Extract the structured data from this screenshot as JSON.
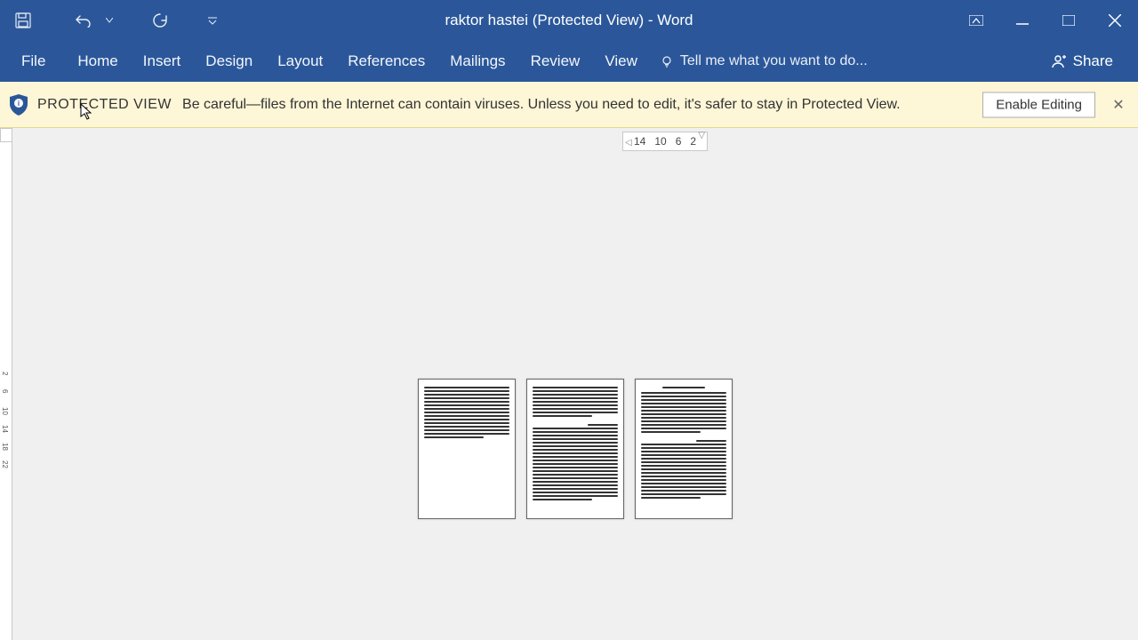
{
  "titlebar": {
    "title": "raktor hastei (Protected View) - Word"
  },
  "ribbon": {
    "tabs": [
      "File",
      "Home",
      "Insert",
      "Design",
      "Layout",
      "References",
      "Mailings",
      "Review",
      "View"
    ],
    "tellme_placeholder": "Tell me what you want to do...",
    "share": "Share"
  },
  "protected_view": {
    "title": "PROTECTED VIEW",
    "message": "Be careful—files from the Internet can contain viruses. Unless you need to edit, it's safer to stay in Protected View.",
    "enable": "Enable Editing"
  },
  "hruler": {
    "ticks": [
      "14",
      "10",
      "6",
      "2"
    ]
  },
  "vruler": {
    "ticks": [
      "2",
      "6",
      "10",
      "14",
      "18",
      "22"
    ]
  }
}
